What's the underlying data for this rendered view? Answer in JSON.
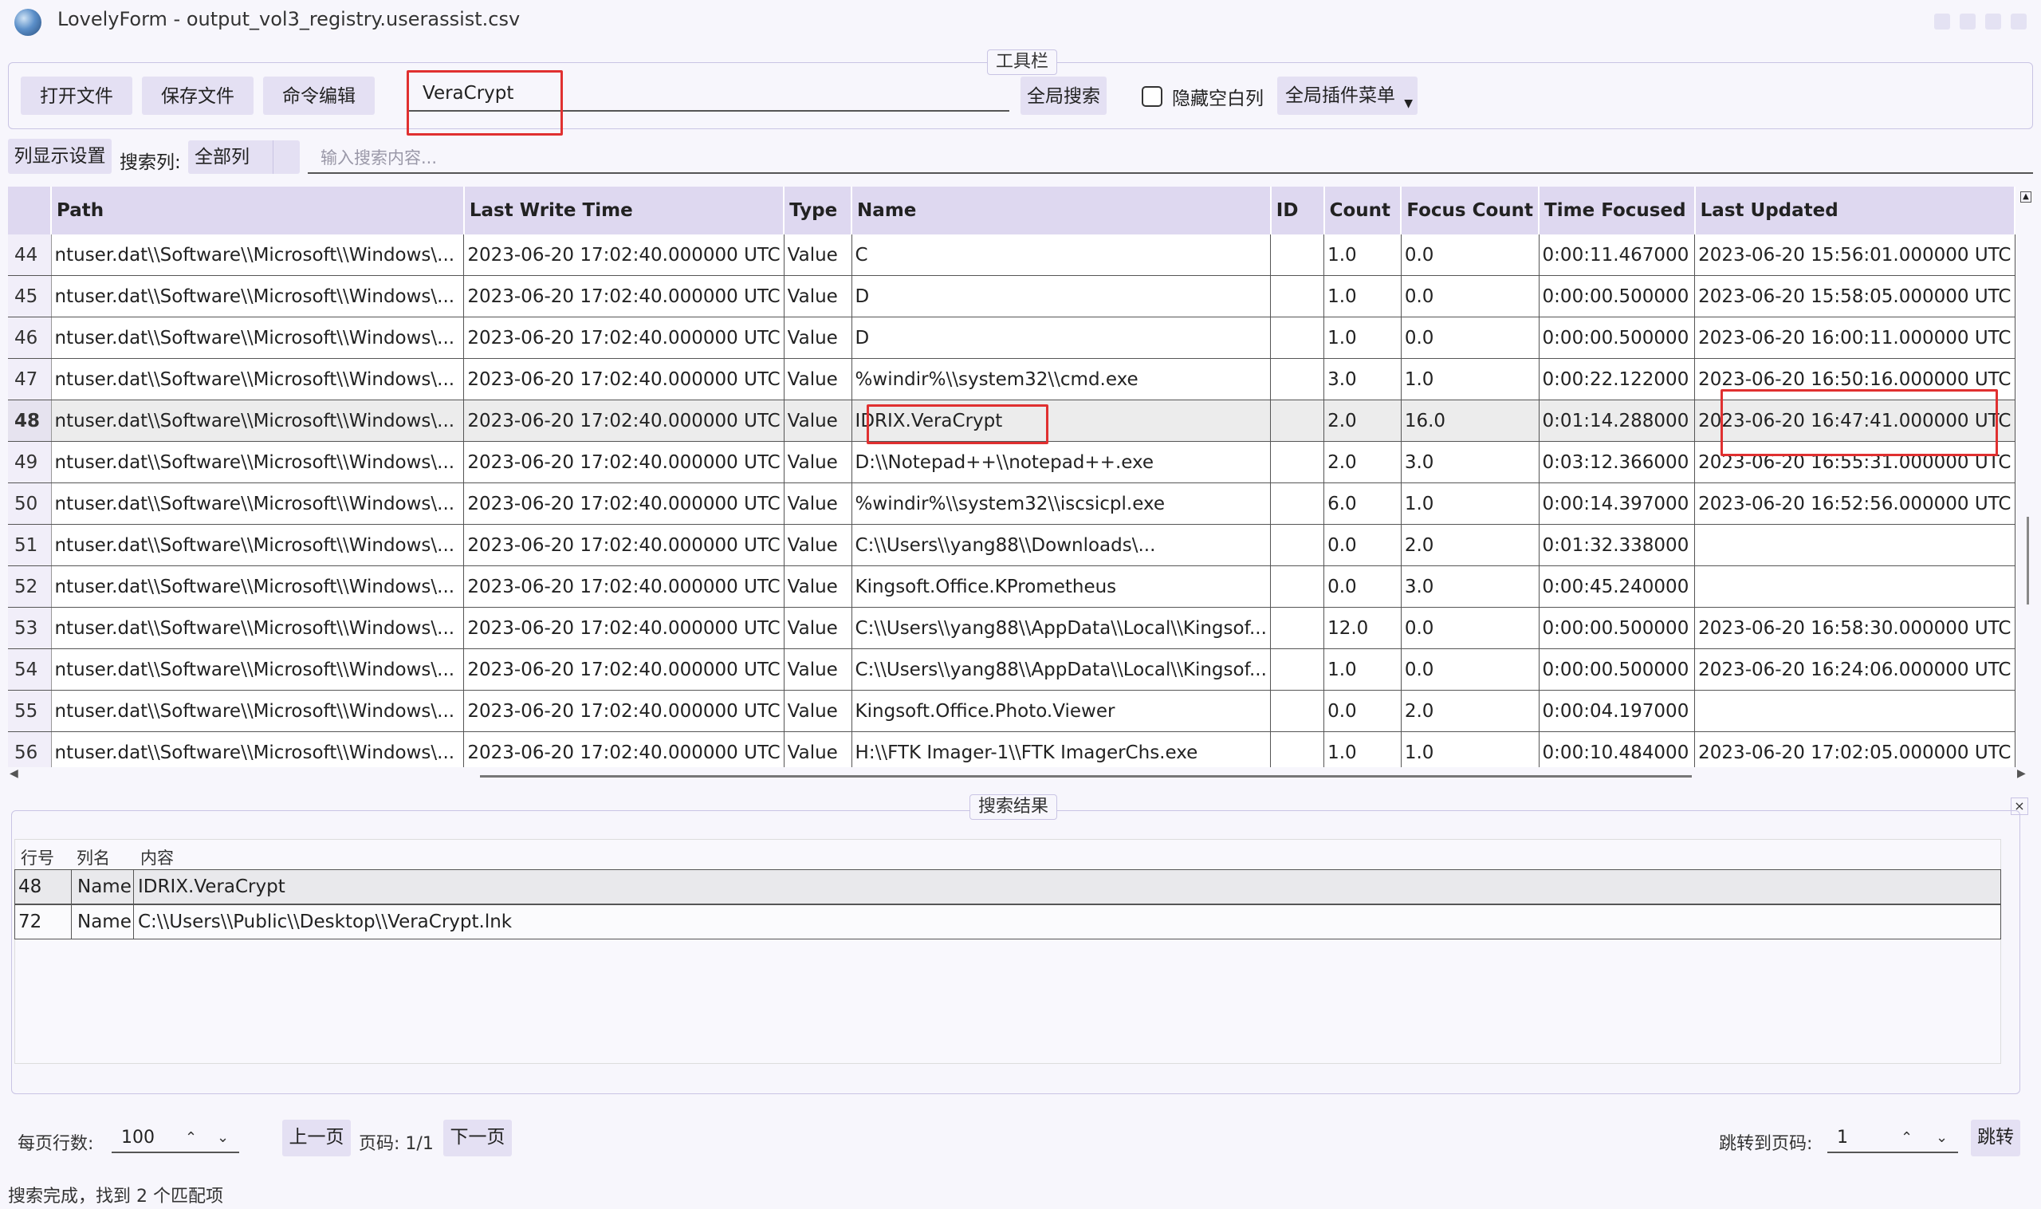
{
  "window": {
    "title": "LovelyForm - output_vol3_registry.userassist.csv"
  },
  "toolbar": {
    "legend": "工具栏",
    "open_file": "打开文件",
    "save_file": "保存文件",
    "command_edit": "命令编辑",
    "search_value": "VeraCrypt",
    "global_search": "全局搜索",
    "hide_empty_cols": "隐藏空白列",
    "plugin_menu": "全局插件菜单"
  },
  "search_row": {
    "col_settings": "列显示设置",
    "search_col_label": "搜索列:",
    "search_col_value": "全部列",
    "search_placeholder": "输入搜索内容..."
  },
  "table": {
    "columns": [
      "Path",
      "Last Write Time",
      "Type",
      "Name",
      "ID",
      "Count",
      "Focus Count",
      "Time Focused",
      "Last Updated"
    ],
    "selected_row": "48",
    "rows": [
      {
        "n": "44",
        "path": "ntuser.dat\\\\Software\\\\Microsoft\\\\Windows\\...",
        "lwt": "2023-06-20 17:02:40.000000 UTC",
        "type": "Value",
        "name": "C",
        "id": "",
        "count": "1.0",
        "focus": "0.0",
        "tf": "0:00:11.467000",
        "lu": "2023-06-20 15:56:01.000000 UTC"
      },
      {
        "n": "45",
        "path": "ntuser.dat\\\\Software\\\\Microsoft\\\\Windows\\...",
        "lwt": "2023-06-20 17:02:40.000000 UTC",
        "type": "Value",
        "name": "D",
        "id": "",
        "count": "1.0",
        "focus": "0.0",
        "tf": "0:00:00.500000",
        "lu": "2023-06-20 15:58:05.000000 UTC"
      },
      {
        "n": "46",
        "path": "ntuser.dat\\\\Software\\\\Microsoft\\\\Windows\\...",
        "lwt": "2023-06-20 17:02:40.000000 UTC",
        "type": "Value",
        "name": "D",
        "id": "",
        "count": "1.0",
        "focus": "0.0",
        "tf": "0:00:00.500000",
        "lu": "2023-06-20 16:00:11.000000 UTC"
      },
      {
        "n": "47",
        "path": "ntuser.dat\\\\Software\\\\Microsoft\\\\Windows\\...",
        "lwt": "2023-06-20 17:02:40.000000 UTC",
        "type": "Value",
        "name": "%windir%\\\\system32\\\\cmd.exe",
        "id": "",
        "count": "3.0",
        "focus": "1.0",
        "tf": "0:00:22.122000",
        "lu": "2023-06-20 16:50:16.000000 UTC"
      },
      {
        "n": "48",
        "path": "ntuser.dat\\\\Software\\\\Microsoft\\\\Windows\\...",
        "lwt": "2023-06-20 17:02:40.000000 UTC",
        "type": "Value",
        "name": "IDRIX.VeraCrypt",
        "id": "",
        "count": "2.0",
        "focus": "16.0",
        "tf": "0:01:14.288000",
        "lu": "2023-06-20 16:47:41.000000 UTC"
      },
      {
        "n": "49",
        "path": "ntuser.dat\\\\Software\\\\Microsoft\\\\Windows\\...",
        "lwt": "2023-06-20 17:02:40.000000 UTC",
        "type": "Value",
        "name": "D:\\\\Notepad++\\\\notepad++.exe",
        "id": "",
        "count": "2.0",
        "focus": "3.0",
        "tf": "0:03:12.366000",
        "lu": "2023-06-20 16:55:31.000000 UTC"
      },
      {
        "n": "50",
        "path": "ntuser.dat\\\\Software\\\\Microsoft\\\\Windows\\...",
        "lwt": "2023-06-20 17:02:40.000000 UTC",
        "type": "Value",
        "name": "%windir%\\\\system32\\\\iscsicpl.exe",
        "id": "",
        "count": "6.0",
        "focus": "1.0",
        "tf": "0:00:14.397000",
        "lu": "2023-06-20 16:52:56.000000 UTC"
      },
      {
        "n": "51",
        "path": "ntuser.dat\\\\Software\\\\Microsoft\\\\Windows\\...",
        "lwt": "2023-06-20 17:02:40.000000 UTC",
        "type": "Value",
        "name": "C:\\\\Users\\\\yang88\\\\Downloads\\...",
        "id": "",
        "count": "0.0",
        "focus": "2.0",
        "tf": "0:01:32.338000",
        "lu": ""
      },
      {
        "n": "52",
        "path": "ntuser.dat\\\\Software\\\\Microsoft\\\\Windows\\...",
        "lwt": "2023-06-20 17:02:40.000000 UTC",
        "type": "Value",
        "name": "Kingsoft.Office.KPrometheus",
        "id": "",
        "count": "0.0",
        "focus": "3.0",
        "tf": "0:00:45.240000",
        "lu": ""
      },
      {
        "n": "53",
        "path": "ntuser.dat\\\\Software\\\\Microsoft\\\\Windows\\...",
        "lwt": "2023-06-20 17:02:40.000000 UTC",
        "type": "Value",
        "name": "C:\\\\Users\\\\yang88\\\\AppData\\\\Local\\\\Kingsof...",
        "id": "",
        "count": "12.0",
        "focus": "0.0",
        "tf": "0:00:00.500000",
        "lu": "2023-06-20 16:58:30.000000 UTC"
      },
      {
        "n": "54",
        "path": "ntuser.dat\\\\Software\\\\Microsoft\\\\Windows\\...",
        "lwt": "2023-06-20 17:02:40.000000 UTC",
        "type": "Value",
        "name": "C:\\\\Users\\\\yang88\\\\AppData\\\\Local\\\\Kingsof...",
        "id": "",
        "count": "1.0",
        "focus": "0.0",
        "tf": "0:00:00.500000",
        "lu": "2023-06-20 16:24:06.000000 UTC"
      },
      {
        "n": "55",
        "path": "ntuser.dat\\\\Software\\\\Microsoft\\\\Windows\\...",
        "lwt": "2023-06-20 17:02:40.000000 UTC",
        "type": "Value",
        "name": "Kingsoft.Office.Photo.Viewer",
        "id": "",
        "count": "0.0",
        "focus": "2.0",
        "tf": "0:00:04.197000",
        "lu": ""
      },
      {
        "n": "56",
        "path": "ntuser.dat\\\\Software\\\\Microsoft\\\\Windows\\...",
        "lwt": "2023-06-20 17:02:40.000000 UTC",
        "type": "Value",
        "name": "H:\\\\FTK Imager-1\\\\FTK ImagerChs.exe",
        "id": "",
        "count": "1.0",
        "focus": "1.0",
        "tf": "0:00:10.484000",
        "lu": "2023-06-20 17:02:05.000000 UTC"
      }
    ]
  },
  "results": {
    "legend": "搜索结果",
    "close": "×",
    "headers": {
      "row": "行号",
      "col": "列名",
      "content": "内容"
    },
    "rows": [
      {
        "row": "48",
        "col": "Name",
        "content": "IDRIX.VeraCrypt"
      },
      {
        "row": "72",
        "col": "Name",
        "content": "C:\\\\Users\\\\Public\\\\Desktop\\\\VeraCrypt.lnk"
      }
    ]
  },
  "pagination": {
    "rows_per_page_label": "每页行数:",
    "rows_per_page": "100",
    "prev": "上一页",
    "page_info": "页码: 1/1",
    "next": "下一页",
    "jump_label": "跳转到页码:",
    "jump_value": "1",
    "jump_button": "跳转"
  },
  "status": {
    "text": "搜索完成，找到 2 个匹配项"
  },
  "colors": {
    "accent": "#ded8f0",
    "button": "#e4e0f3",
    "highlight_box": "#e03030"
  }
}
